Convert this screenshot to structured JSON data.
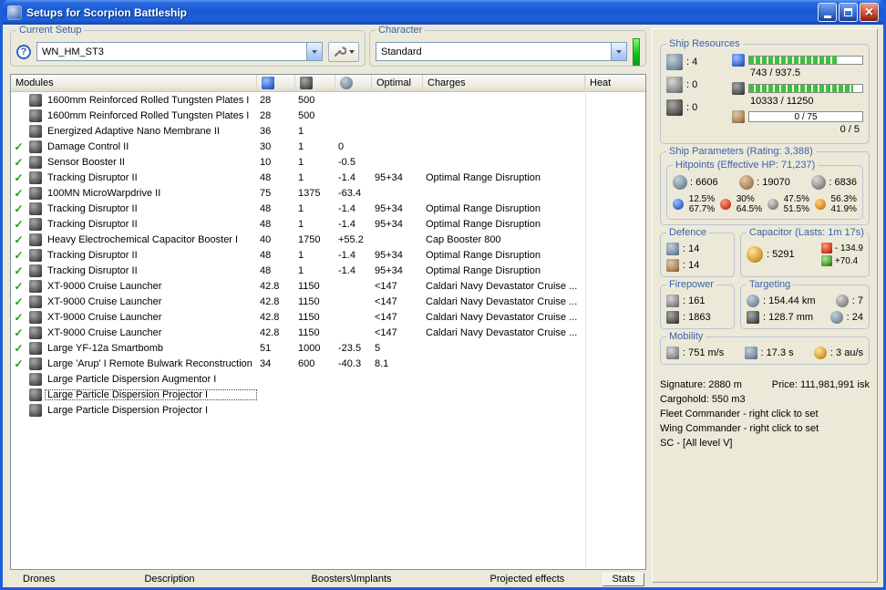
{
  "window": {
    "title": "Setups for Scorpion Battleship"
  },
  "setup": {
    "group_label": "Current Setup",
    "value": "WN_HM_ST3"
  },
  "character": {
    "group_label": "Character",
    "value": "Standard"
  },
  "table": {
    "headers": {
      "modules": "Modules",
      "optimal": "Optimal",
      "charges": "Charges",
      "heat": "Heat"
    },
    "rows": [
      {
        "checked": false,
        "selected": false,
        "name": "1600mm Reinforced Rolled Tungsten Plates I",
        "cpu": "28",
        "pg": "500",
        "cap": "",
        "optimal": "",
        "charge": ""
      },
      {
        "checked": false,
        "selected": false,
        "name": "1600mm Reinforced Rolled Tungsten Plates I",
        "cpu": "28",
        "pg": "500",
        "cap": "",
        "optimal": "",
        "charge": ""
      },
      {
        "checked": false,
        "selected": false,
        "name": "Energized Adaptive Nano Membrane II",
        "cpu": "36",
        "pg": "1",
        "cap": "",
        "optimal": "",
        "charge": ""
      },
      {
        "checked": true,
        "selected": false,
        "name": "Damage Control II",
        "cpu": "30",
        "pg": "1",
        "cap": "0",
        "optimal": "",
        "charge": ""
      },
      {
        "checked": true,
        "selected": false,
        "name": "Sensor Booster II",
        "cpu": "10",
        "pg": "1",
        "cap": "-0.5",
        "optimal": "",
        "charge": ""
      },
      {
        "checked": true,
        "selected": false,
        "name": "Tracking Disruptor II",
        "cpu": "48",
        "pg": "1",
        "cap": "-1.4",
        "optimal": "95+34",
        "charge": "Optimal Range Disruption"
      },
      {
        "checked": true,
        "selected": false,
        "name": "100MN MicroWarpdrive II",
        "cpu": "75",
        "pg": "1375",
        "cap": "-63.4",
        "optimal": "",
        "charge": ""
      },
      {
        "checked": true,
        "selected": false,
        "name": "Tracking Disruptor II",
        "cpu": "48",
        "pg": "1",
        "cap": "-1.4",
        "optimal": "95+34",
        "charge": "Optimal Range Disruption"
      },
      {
        "checked": true,
        "selected": false,
        "name": "Tracking Disruptor II",
        "cpu": "48",
        "pg": "1",
        "cap": "-1.4",
        "optimal": "95+34",
        "charge": "Optimal Range Disruption"
      },
      {
        "checked": true,
        "selected": false,
        "name": "Heavy Electrochemical Capacitor Booster I",
        "cpu": "40",
        "pg": "1750",
        "cap": "+55.2",
        "optimal": "",
        "charge": "Cap Booster 800"
      },
      {
        "checked": true,
        "selected": false,
        "name": "Tracking Disruptor II",
        "cpu": "48",
        "pg": "1",
        "cap": "-1.4",
        "optimal": "95+34",
        "charge": "Optimal Range Disruption"
      },
      {
        "checked": true,
        "selected": false,
        "name": "Tracking Disruptor II",
        "cpu": "48",
        "pg": "1",
        "cap": "-1.4",
        "optimal": "95+34",
        "charge": "Optimal Range Disruption"
      },
      {
        "checked": true,
        "selected": false,
        "name": "XT-9000 Cruise Launcher",
        "cpu": "42.8",
        "pg": "1150",
        "cap": "",
        "optimal": "<147",
        "charge": "Caldari Navy Devastator Cruise ..."
      },
      {
        "checked": true,
        "selected": false,
        "name": "XT-9000 Cruise Launcher",
        "cpu": "42.8",
        "pg": "1150",
        "cap": "",
        "optimal": "<147",
        "charge": "Caldari Navy Devastator Cruise ..."
      },
      {
        "checked": true,
        "selected": false,
        "name": "XT-9000 Cruise Launcher",
        "cpu": "42.8",
        "pg": "1150",
        "cap": "",
        "optimal": "<147",
        "charge": "Caldari Navy Devastator Cruise ..."
      },
      {
        "checked": true,
        "selected": false,
        "name": "XT-9000 Cruise Launcher",
        "cpu": "42.8",
        "pg": "1150",
        "cap": "",
        "optimal": "<147",
        "charge": "Caldari Navy Devastator Cruise ..."
      },
      {
        "checked": true,
        "selected": false,
        "name": "Large YF-12a Smartbomb",
        "cpu": "51",
        "pg": "1000",
        "cap": "-23.5",
        "optimal": "5",
        "charge": ""
      },
      {
        "checked": true,
        "selected": false,
        "name": "Large 'Arup' I Remote Bulwark Reconstruction",
        "cpu": "34",
        "pg": "600",
        "cap": "-40.3",
        "optimal": "8.1",
        "charge": ""
      },
      {
        "checked": false,
        "selected": false,
        "name": "Large Particle Dispersion Augmentor I",
        "cpu": "",
        "pg": "",
        "cap": "",
        "optimal": "",
        "charge": ""
      },
      {
        "checked": false,
        "selected": true,
        "name": "Large Particle Dispersion Projector I",
        "cpu": "",
        "pg": "",
        "cap": "",
        "optimal": "",
        "charge": ""
      },
      {
        "checked": false,
        "selected": false,
        "name": "Large Particle Dispersion Projector I",
        "cpu": "",
        "pg": "",
        "cap": "",
        "optimal": "",
        "charge": ""
      }
    ]
  },
  "tabs": {
    "items": [
      "Drones",
      "Description",
      "Boosters\\Implants",
      "Projected effects"
    ],
    "stats": "Stats"
  },
  "resources": {
    "group_label": "Ship Resources",
    "turrets": ": 4",
    "launchers": ": 0",
    "rigs": ": 0",
    "cpu_text": "743 / 937.5",
    "cpu_pct": 79,
    "pg_text": "10333 / 11250",
    "pg_pct": 92,
    "drone_bw_text": "0 / 75",
    "drones_text": "0 / 5"
  },
  "parameters": {
    "group_label": "Ship Parameters (Rating: 3,388)",
    "hitpoints_label": "Hitpoints (Effective HP: 71,237)",
    "shield_hp": ": 6606",
    "armor_hp": ": 19070",
    "hull_hp": ": 6836",
    "resists": [
      {
        "shield": "12.5%",
        "armor": "67.7%"
      },
      {
        "shield": "30%",
        "armor": "64.5%"
      },
      {
        "shield": "47.5%",
        "armor": "51.5%"
      },
      {
        "shield": "56.3%",
        "armor": "41.9%"
      }
    ]
  },
  "defence": {
    "group_label": "Defence",
    "value1": ": 14",
    "value2": ": 14"
  },
  "capacitor": {
    "group_label": "Capacitor (Lasts: 1m 17s)",
    "amount": ": 5291",
    "drain": "- 134.9",
    "recharge": "+70.4"
  },
  "firepower": {
    "group_label": "Firepower",
    "volley": ": 161",
    "dps": ": 1863"
  },
  "targeting": {
    "group_label": "Targeting",
    "range": ": 154.44 km",
    "max_targets": ": 7",
    "scan_res": ": 128.7 mm",
    "sensor_str": ": 24"
  },
  "mobility": {
    "group_label": "Mobility",
    "speed": ": 751 m/s",
    "align": ": 17.3 s",
    "warp": ": 3 au/s"
  },
  "info": {
    "signature": "Signature: 2880 m",
    "price": "Price: 111,981,991 isk",
    "cargohold": "Cargohold: 550 m3",
    "fleet_commander": "Fleet Commander - right click to set",
    "wing_commander": "Wing Commander - right click to set",
    "sc": "SC - [All level V]"
  }
}
